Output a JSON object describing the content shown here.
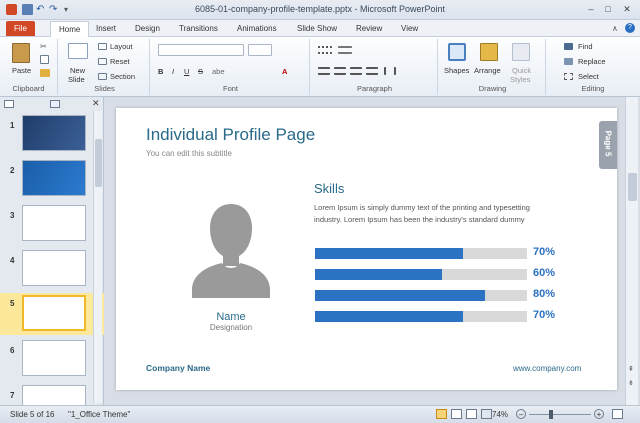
{
  "window": {
    "title": "6085-01-company-profile-template.pptx - Microsoft PowerPoint"
  },
  "tabs": [
    {
      "label": "File"
    },
    {
      "label": "Home"
    },
    {
      "label": "Insert"
    },
    {
      "label": "Design"
    },
    {
      "label": "Transitions"
    },
    {
      "label": "Animations"
    },
    {
      "label": "Slide Show"
    },
    {
      "label": "Review"
    },
    {
      "label": "View"
    }
  ],
  "ribbon": {
    "clipboard": {
      "label": "Clipboard",
      "paste": "Paste"
    },
    "slides": {
      "label": "Slides",
      "new_slide_line1": "New",
      "new_slide_line2": "Slide",
      "layout": "Layout",
      "reset": "Reset",
      "section": "Section"
    },
    "font": {
      "label": "Font"
    },
    "paragraph": {
      "label": "Paragraph"
    },
    "drawing": {
      "label": "Drawing",
      "shapes": "Shapes",
      "arrange": "Arrange",
      "quick_styles_line1": "Quick",
      "quick_styles_line2": "Styles"
    },
    "editing": {
      "label": "Editing",
      "find": "Find",
      "replace": "Replace",
      "select": "Select"
    }
  },
  "thumbnails": [
    {
      "num": "1"
    },
    {
      "num": "2"
    },
    {
      "num": "3"
    },
    {
      "num": "4"
    },
    {
      "num": "5"
    },
    {
      "num": "6"
    },
    {
      "num": "7"
    }
  ],
  "slide": {
    "title": "Individual Profile Page",
    "subtitle": "You can edit this subtitle",
    "page_tab": "Page 5",
    "name": "Name",
    "designation": "Designation",
    "skills_heading": "Skills",
    "skills_text": "Lorem Ipsum is simply dummy text of the printing and typesetting industry. Lorem Ipsum has been the industry's standard dummy",
    "skills": [
      {
        "value": 0.7,
        "label": "70%"
      },
      {
        "value": 0.6,
        "label": "60%"
      },
      {
        "value": 0.8,
        "label": "80%"
      },
      {
        "value": 0.7,
        "label": "70%"
      }
    ],
    "company_name": "Company Name",
    "website": "www.company.com"
  },
  "status": {
    "slide_info": "Slide 5 of 16",
    "theme": "\"1_Office Theme\"",
    "zoom": "74%"
  },
  "colors": {
    "accent": "#2b72c2",
    "file_tab": "#d24726",
    "title_text": "#2a6a8a"
  }
}
